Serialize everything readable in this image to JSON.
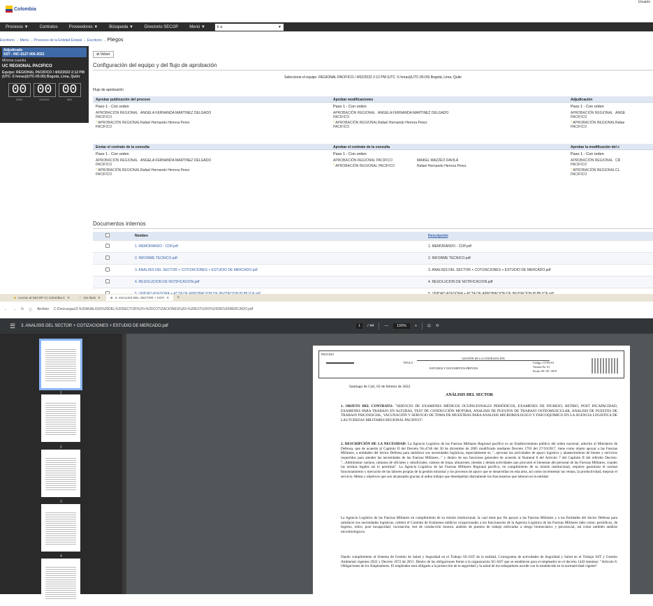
{
  "top": {
    "logo_text": "Colombia",
    "user_label": "Usuario"
  },
  "nav": {
    "items": [
      "Procesos ▼",
      "Contratos",
      "Proveedores ▼",
      "Búsqueda ▼",
      "Directorio SECOP",
      "Menú ▼"
    ],
    "search_value": "Ir a"
  },
  "breadcrumb": {
    "path": "Escritorio → Menú → Procesos de la Entidad Estatal → Escritorio →",
    "current": "Pliegos"
  },
  "side": {
    "status": "Adjudicado",
    "ref": "SST - INC-0127-006-2022",
    "subtitle": "Mínima cuantía",
    "line1": "UC REGIONAL PACIFICO",
    "line2": "Equipo: REGIONAL PACIFICO / 4/02/2022 2:12 PM (UTC -5 horas)(UTC-05:00) Bogotá, Lima, Quito",
    "timer": [
      {
        "value": "00",
        "label": "DÍAS"
      },
      {
        "value": "00",
        "label": "HORAS"
      },
      {
        "value": "00",
        "label": "MIN"
      }
    ]
  },
  "main": {
    "back_label": "Volver",
    "section_title": "Configuración del equipo y del flujo de aprobación",
    "team_label": "Seleccione el equipo",
    "team_value": "REGIONAL PACIFICO / 4/02/2022 2:12 PM (UTC -5 horas)(UTC-05:00) Bogotá, Lima, Quito",
    "flow_label": "Flujo de aprobación",
    "block1": [
      {
        "head": "Aprobar publicación del proceso",
        "step": "Paso 1 - Con orden",
        "rows": [
          {
            "role": "APROBACIÓN REGIONAL PACIFICO",
            "who": "ANGELA FERNANDA MARTINEZ DELGADO"
          },
          {
            "role": "APROBACIÓN REGIONAL PACIFICO",
            "who": "Rafael Hernando Herrera Perez"
          }
        ]
      },
      {
        "head": "Aprobar modificaciones",
        "step": "Paso 1 - Con orden",
        "rows": [
          {
            "role": "APROBACIÓN REGIONAL PACIFICO",
            "who": "ANGELA FERNANDA MARTINEZ DELGADO"
          },
          {
            "role": "APROBACIÓN REGIONAL PACIFICO",
            "who": "Rafael Hernando Herrera Perez"
          }
        ]
      },
      {
        "head": "Adjudicación",
        "step": "Paso 1 - Con orden",
        "rows": [
          {
            "role": "APROBACIÓN REGIONAL PACIFICO",
            "who": "ANGE"
          },
          {
            "role": "APROBACIÓN REGIONAL PACIFICO",
            "who": "Rafae"
          }
        ]
      }
    ],
    "block2": [
      {
        "head": "Enviar el contrato de la consulta",
        "step": "Paso 1 - Con orden",
        "rows": [
          {
            "role": "APROBACIÓN REGIONAL PACIFICO",
            "who": "ANGELA FERNANDA MARTINEZ DELGADO"
          },
          {
            "role": "APROBACIÓN REGIONAL PACIFICO",
            "who": "Rafael Hernando Herrera Perez"
          }
        ]
      },
      {
        "head": "Aprobar el contrato de la consulta",
        "step": "Paso 1 - Con orden",
        "rows": [
          {
            "role": "APROBACIÓN REGIONAL PACIFICO",
            "who": "MAIKEL MAZZEO DAVILA"
          },
          {
            "role": "APROBACIÓN REGIONAL PACIFICO",
            "who": "Rafael Hernando Herrera Perez"
          }
        ]
      },
      {
        "head": "Aprobar la modificación del c",
        "step": "Paso 1 - Con orden",
        "rows": [
          {
            "role": "APROBACIÓN REGIONAL PACIFICO",
            "who": "CR"
          },
          {
            "role": "APROBACIÓN REGIONAL PACIFICO",
            "who": "CL"
          }
        ]
      }
    ],
    "docs_title": "Documentos internos",
    "docs_headers": {
      "name": "Nombre",
      "desc": "Descripción"
    },
    "docs": [
      {
        "name": "1. MEMORANDO - CDP.pdf",
        "desc": "1. MEMORANDO - CDP.pdf"
      },
      {
        "name": "2. INFORME TECNICO.pdf",
        "desc": "2. INFORME TECNICO.pdf"
      },
      {
        "name": "3. ANALISIS DEL SECTOR + COTIZACIONES + ESTUDIO DE MERCADO.pdf",
        "desc": "3. ANALISIS DEL SECTOR + COTIZACIONES + ESTUDIO DE MERCADO.pdf"
      },
      {
        "name": "4. RESOLUCION DE NOTIFICACION.pdf",
        "desc": "4. RESOLUCION DE NOTIFICACION.pdf"
      },
      {
        "name": "5. UNIDAD ASESORA + ACTA DE APROBACION DE INVITACION PUBLICA.pdf",
        "desc": "5. UNIDAD ASESORA + ACTA DE APROBACION DE INVITACION PUBLICA.pdf"
      }
    ]
  },
  "browser": {
    "tabs": [
      "Acceso al SECOP II | Colombia C",
      "Sin título",
      "3. ANALISIS DEL SECTOR + COTI"
    ],
    "url_scheme": "Archivo",
    "url": "C:/Descargas/3.%20ANALISIS%20DEL%20SECTOR%20+%20COTIZACIONES%20+%20ESTUDIO%20DE%20MERCADO.pdf",
    "pdf_title": "3. ANALISIS DEL SECTOR + COTIZACIONES + ESTUDIO DE MERCADO.pdf",
    "page_current": "1",
    "page_total": "/ 44",
    "zoom": "100%",
    "thumb_numbers": [
      "1",
      "2",
      "3",
      "4"
    ]
  },
  "doc": {
    "proceso": "PROCESO",
    "gestion": "GESTIÓN DE LA CONTRATACIÓN",
    "titulo": "TITULO",
    "estudios": "ESTUDIOS Y DOCUMENTOS PREVIOS",
    "codigo": "Código: CT-FO-01",
    "version": "Versión No. 01",
    "fecha": "Fecha: 08 / 05 / 2019",
    "date_line": "Santiago de Cali, 02 de febrero de 2022",
    "heading": "ANÁLISIS DEL SECTOR",
    "p1_label": "1. OBJETO DEL CONTRATO:",
    "p1": "\"SERVICIO DE EXAMENES MÉDICOS OCUPACIONALES PERIÓDICOS, EXAMENES DE INGRESO, RETIRO, POST INCAPACIDAD, EXAMENES PARA TRABAJO EN ALTURAS, TEST DE CONDUCCIÓN MOTORA, ANALISIS DE PUESTOS DE TRABAJO OSTEOMUSCULAR, ANALISIS DE PUESTOS DE TRABAJO PSICOSOCIAL, VACUNACIÓN Y SERVICIO DE TOMA DE MUESTRAS PARA ANALISIS MICROBIOLOGICO Y FISICOQUIMICO EN LA AGENCIA LOGISTICA DE LAS FUERZAS MILITARES REGIONAL PACIFICO\".",
    "p2_label": "2. DESCRIPCIÓN DE LA NECESIDAD:",
    "p2": "La Agencia Logística de las Fuerzas Militares Regional pacífico es un Establecimiento público del orden nacional, adscrito al Ministerio de Defensa, que de acuerdo al Capítulo II del Decreto No.4746 del 30 de diciembre de 2005 modificado mediante Decreto 1793 del 27/10/2017, tiene como objeto apoyar a las Fuerzas Militares, a entidades del Sector Defensa para satisfacer sus necesidades logísticas, especialmente en \"...ejecutar las actividades de apoyo logístico y abastecimiento de bienes y servicios requeridos para atender las necesidades de las Fuerzas Militares...\" y dentro de sus funciones generales de acuerdo al Numeral 8 del Artículo 7 del Capítulo II del referido Decreto: \"...Administrar casinos, cámaras de oficiales y suboficiales, casinos de tropa, almacenes, tiendas y demás actividades que procuren el bienestar del personal de las Fuerzas Militares, cuando las normas legales así lo permitan\". La Agencia Logística de las Fuerzas Militares Regional pacífico, en cumplimiento de su misión institucional, requiere garantizar el normal funcionamiento y ejecución de las labores propias de la gestión misional y los procesos de apoyo que se desarrollan en esta área, así como incrementar las ventas, la productividad, mejorar el servicio. Metas y objetivos que son alcanzados gracias al arduo trabajo que desempeñan diariamente los funcionarios que laboran en la entidad.",
    "p3": "La Agencia Logística de las Fuerzas Militares en cumplimiento de su misión institucional, la cual tiene por fin apoyar a las Fuerzas Militares y a las Entidades del Sector Defensa para satisfacer sus necesidades logísticas, celebra el Contrato de Exámenes médicos ocupacionales a los funcionarios de la Agencia Logística de las Fuerzas Militares tales como: periódicos, de Ingreso, retiro, post incapacidad, vacunación, test de conducción motora, análisis de puestos de trabajo enfocados a riesgo biomecánico y psicosocial, así como también análisis microbiológicos.",
    "p4": "Dando cumplimiento al Sistema de Gestión de Salud y Seguridad en el Trabajo SG-SST de la entidad, Cronograma de actividades de Seguridad y Salud en el Trabajo SST y Gestión Ambiental vigentes 2022 y Decreto 1072 de 2015. Dentro de las obligaciones frente a la organización SG-SST que se establecen para el empleador en el decreto 1443 tenemos: \"Artículo 8. Obligaciones de los Empleadores. El empleador está obligado a la protección de la seguridad y la salud de los trabajadores acorde con lo establecido en la normatividad vigente\"."
  }
}
